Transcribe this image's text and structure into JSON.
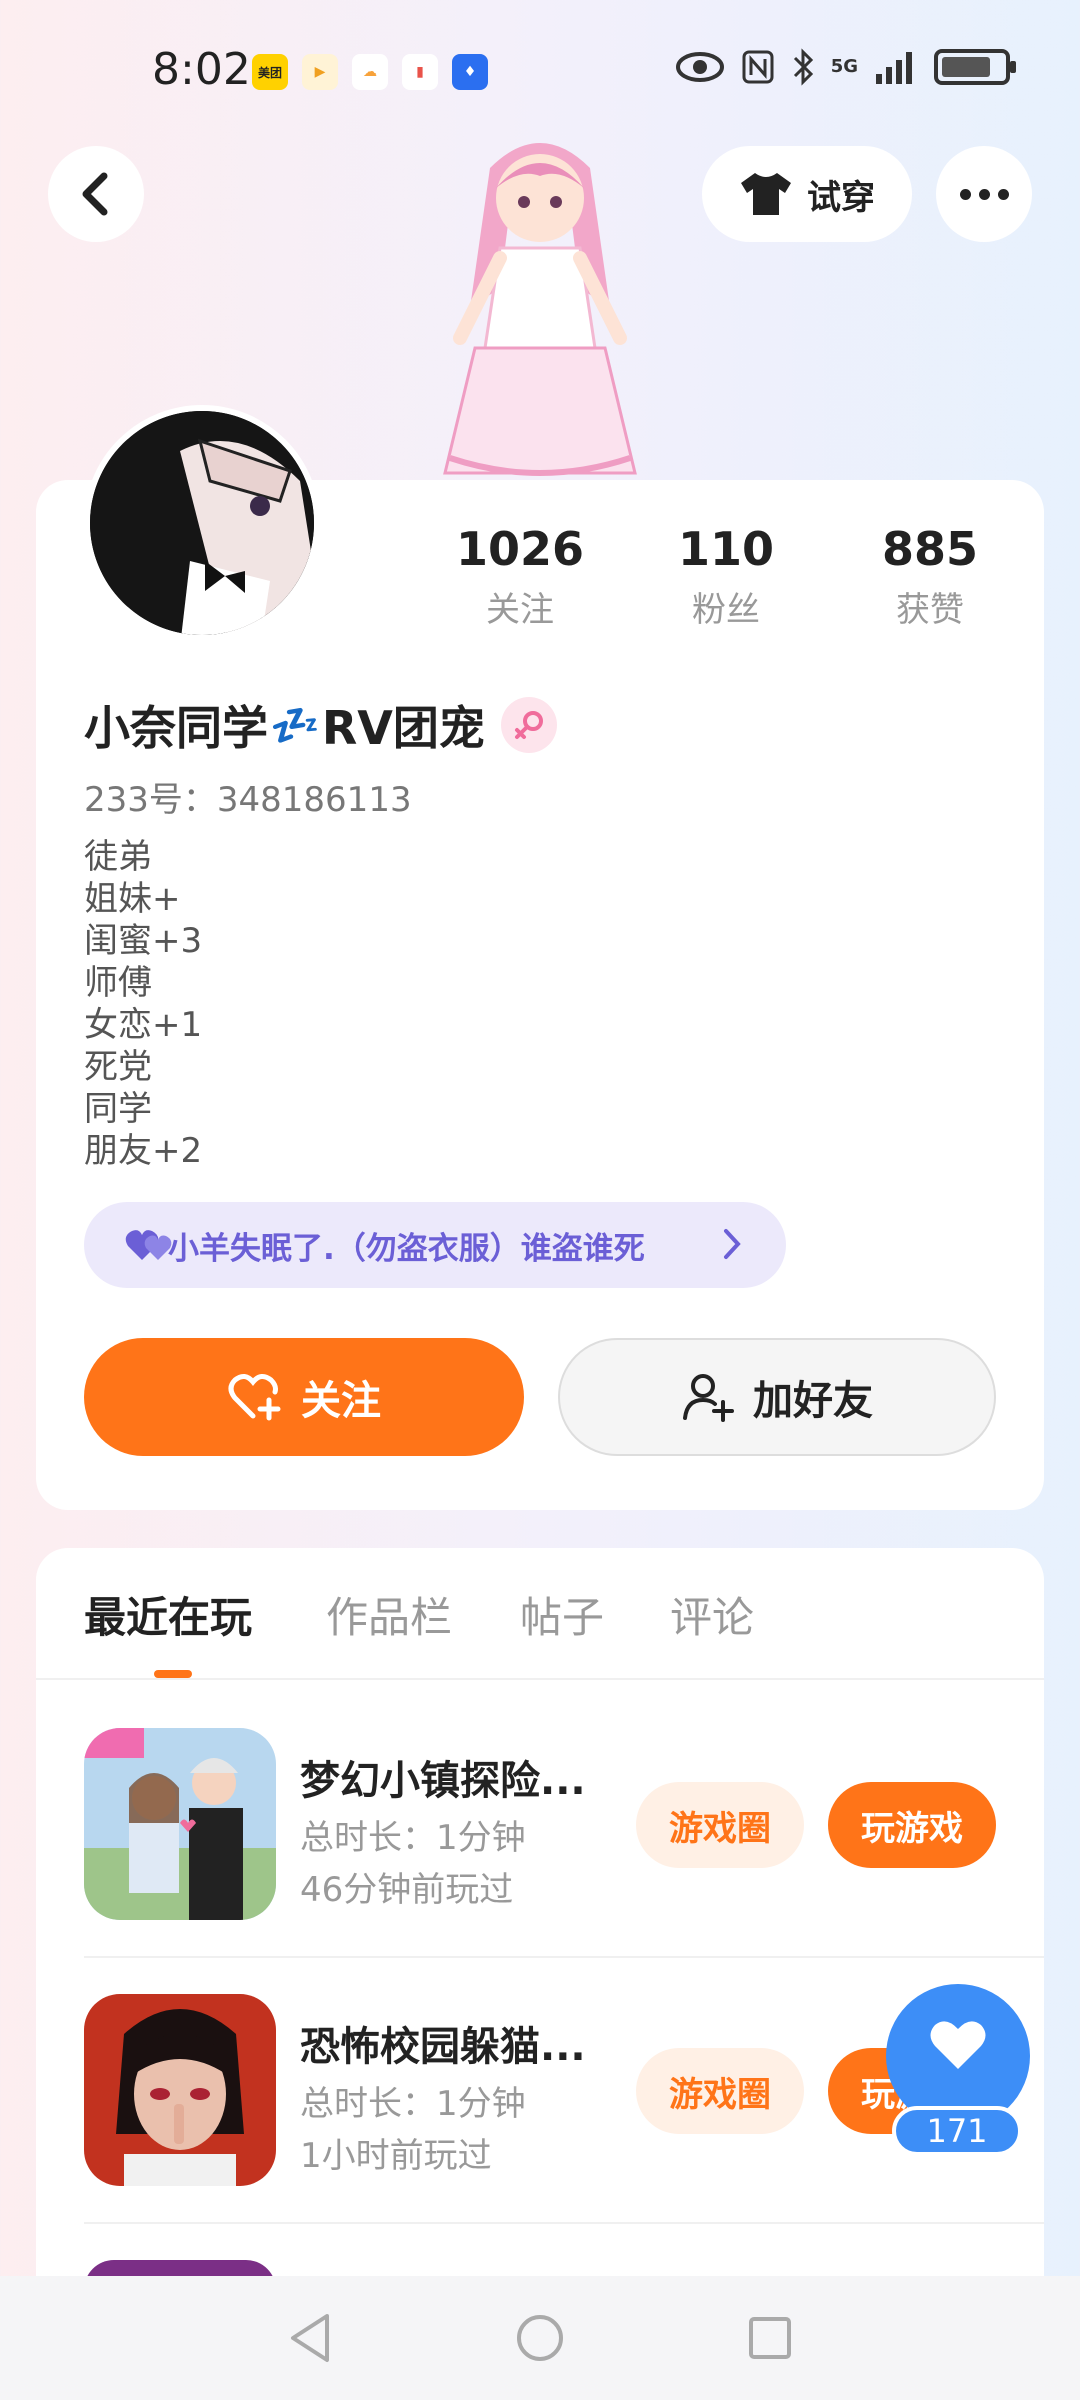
{
  "status_bar": {
    "time": "8:02",
    "apps": [
      "美团",
      "▶",
      "☁",
      "▮",
      "♦"
    ],
    "network": "5G"
  },
  "top_nav": {
    "try_on_label": "试穿"
  },
  "profile": {
    "stats": [
      {
        "value": "1026",
        "label": "关注"
      },
      {
        "value": "110",
        "label": "粉丝"
      },
      {
        "value": "885",
        "label": "获赞"
      }
    ],
    "nickname": "小奈同学",
    "nickname_emoji": "💤",
    "nickname_suffix": "RV团宠",
    "user_id": "233号：348186113",
    "bio_lines": [
      "徒弟",
      "姐妹+",
      "闺蜜+3",
      "师傅",
      "女恋+1",
      "死党",
      "同学",
      "朋友+2"
    ],
    "group_text": "小羊失眠了.（勿盗衣服）谁盗谁死",
    "follow_label": "关注",
    "add_friend_label": "加好友"
  },
  "tabs": {
    "items": [
      "最近在玩",
      "作品栏",
      "帖子",
      "评论"
    ],
    "active_index": 0
  },
  "games": [
    {
      "title": "梦幻小镇探险...",
      "duration": "总时长：1分钟",
      "last_played": "46分钟前玩过",
      "circle_label": "游戏圈",
      "play_label": "玩游戏"
    },
    {
      "title": "恐怖校园躲猫...",
      "duration": "总时长：1分钟",
      "last_played": "1小时前玩过",
      "circle_label": "游戏圈",
      "play_label": "玩游戏"
    }
  ],
  "like_fab": {
    "count": "171"
  },
  "colors": {
    "accent": "#ff7418",
    "like_blue": "#3d8ef7",
    "group_purple": "#6b5fd6"
  }
}
